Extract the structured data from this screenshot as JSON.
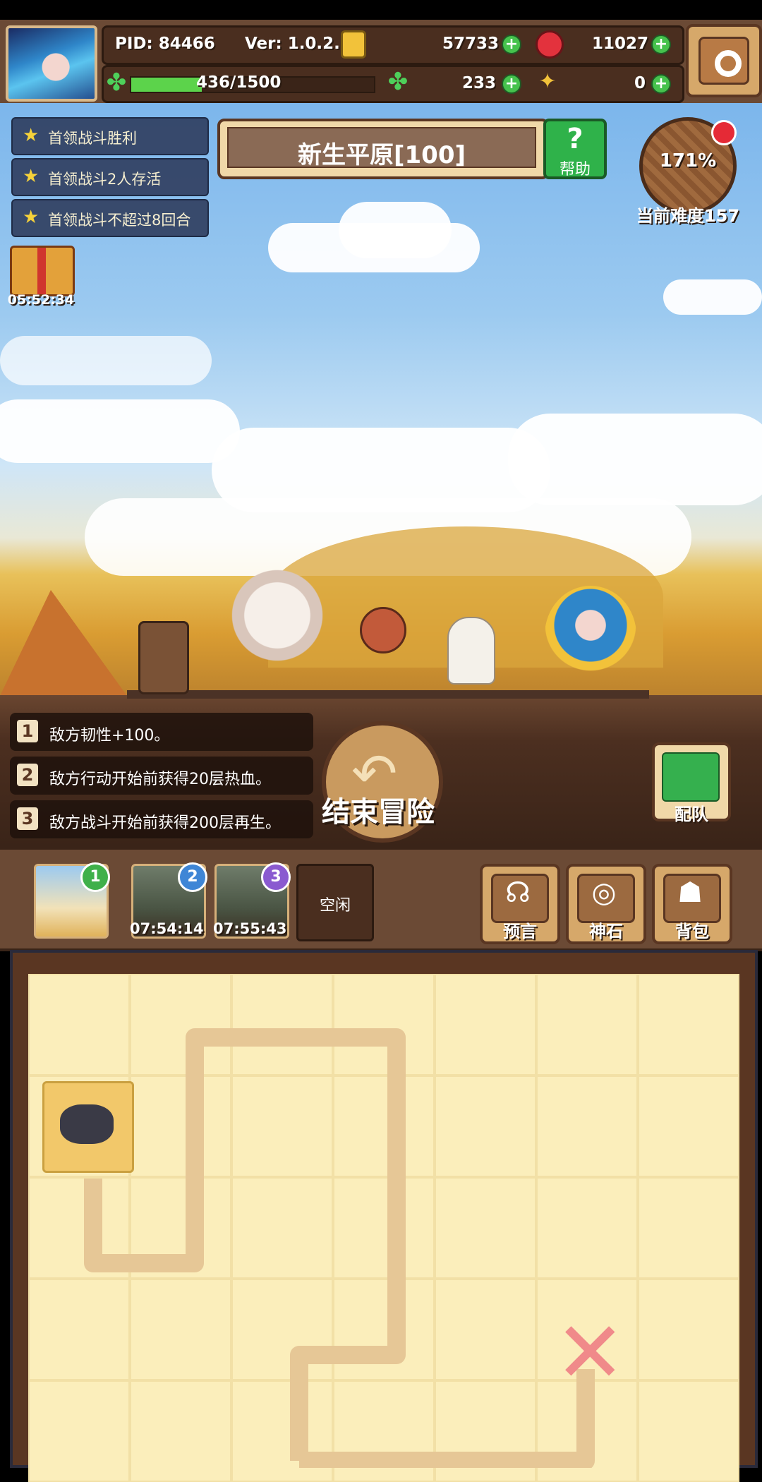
{
  "header": {
    "pid": "PID: 84466",
    "version": "Ver: 1.0.2.1",
    "gold": "57733",
    "ruby": "11027",
    "energy": "436/1500",
    "energy_fraction": 0.29,
    "clover": "233",
    "horn": "0",
    "plus": "+"
  },
  "quests": [
    {
      "text": "首领战斗胜利"
    },
    {
      "text": "首领战斗2人存活"
    },
    {
      "text": "首领战斗不超过8回合"
    }
  ],
  "stage": {
    "title": "新生平原[100]",
    "help_label": "帮助",
    "help_glyph": "?"
  },
  "difficulty": {
    "percent": "171%",
    "label": "当前难度157"
  },
  "gift": {
    "timer": "05:52:34"
  },
  "rules": [
    {
      "num": "1",
      "text": "敌方韧性+100。"
    },
    {
      "num": "2",
      "text": "敌方行动开始前获得20层热血。"
    },
    {
      "num": "3",
      "text": "敌方战斗开始前获得200层再生。"
    }
  ],
  "actions": {
    "end_label": "结束冒险",
    "team_label": "配队"
  },
  "slots": [
    {
      "badge": "1",
      "timer": ""
    },
    {
      "badge": "2",
      "timer": "07:54:14"
    },
    {
      "badge": "3",
      "timer": "07:55:43"
    }
  ],
  "idle_label": "空闲",
  "tools": [
    {
      "label": "预言",
      "icon": "prophecy-icon"
    },
    {
      "label": "神石",
      "icon": "godstone-icon"
    },
    {
      "label": "背包",
      "icon": "backpack-icon"
    }
  ],
  "colors": {
    "badge1": "#3fb04a",
    "badge2": "#3f86d6",
    "badge3": "#8a5ad0",
    "accent_green": "#46c24d"
  }
}
